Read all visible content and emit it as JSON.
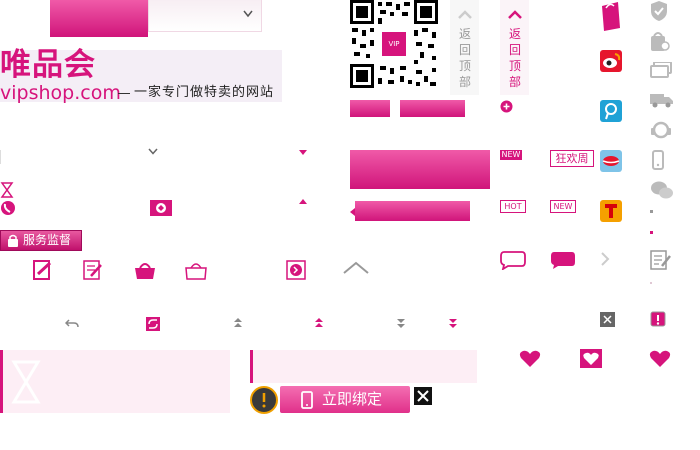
{
  "logo": {
    "chinese": "唯品会",
    "latin": "vipshop.com",
    "slogan": "一家专门做特卖的网站"
  },
  "back_to_top_1": {
    "chars": [
      "返",
      "回",
      "顶",
      "部"
    ]
  },
  "back_to_top_2": {
    "chars": [
      "返",
      "回",
      "顶",
      "部"
    ]
  },
  "service_badge": {
    "label": "服务监督"
  },
  "bind_button": {
    "label": "立即绑定"
  },
  "badges": {
    "new1": "NEW",
    "carnival": "狂欢周",
    "hot": "HOT",
    "new2": "NEW"
  },
  "qr_center": "VIP",
  "colors": {
    "brand": "#d6147c",
    "brand_light": "#f05aa8",
    "pale": "#fbe9f2"
  }
}
